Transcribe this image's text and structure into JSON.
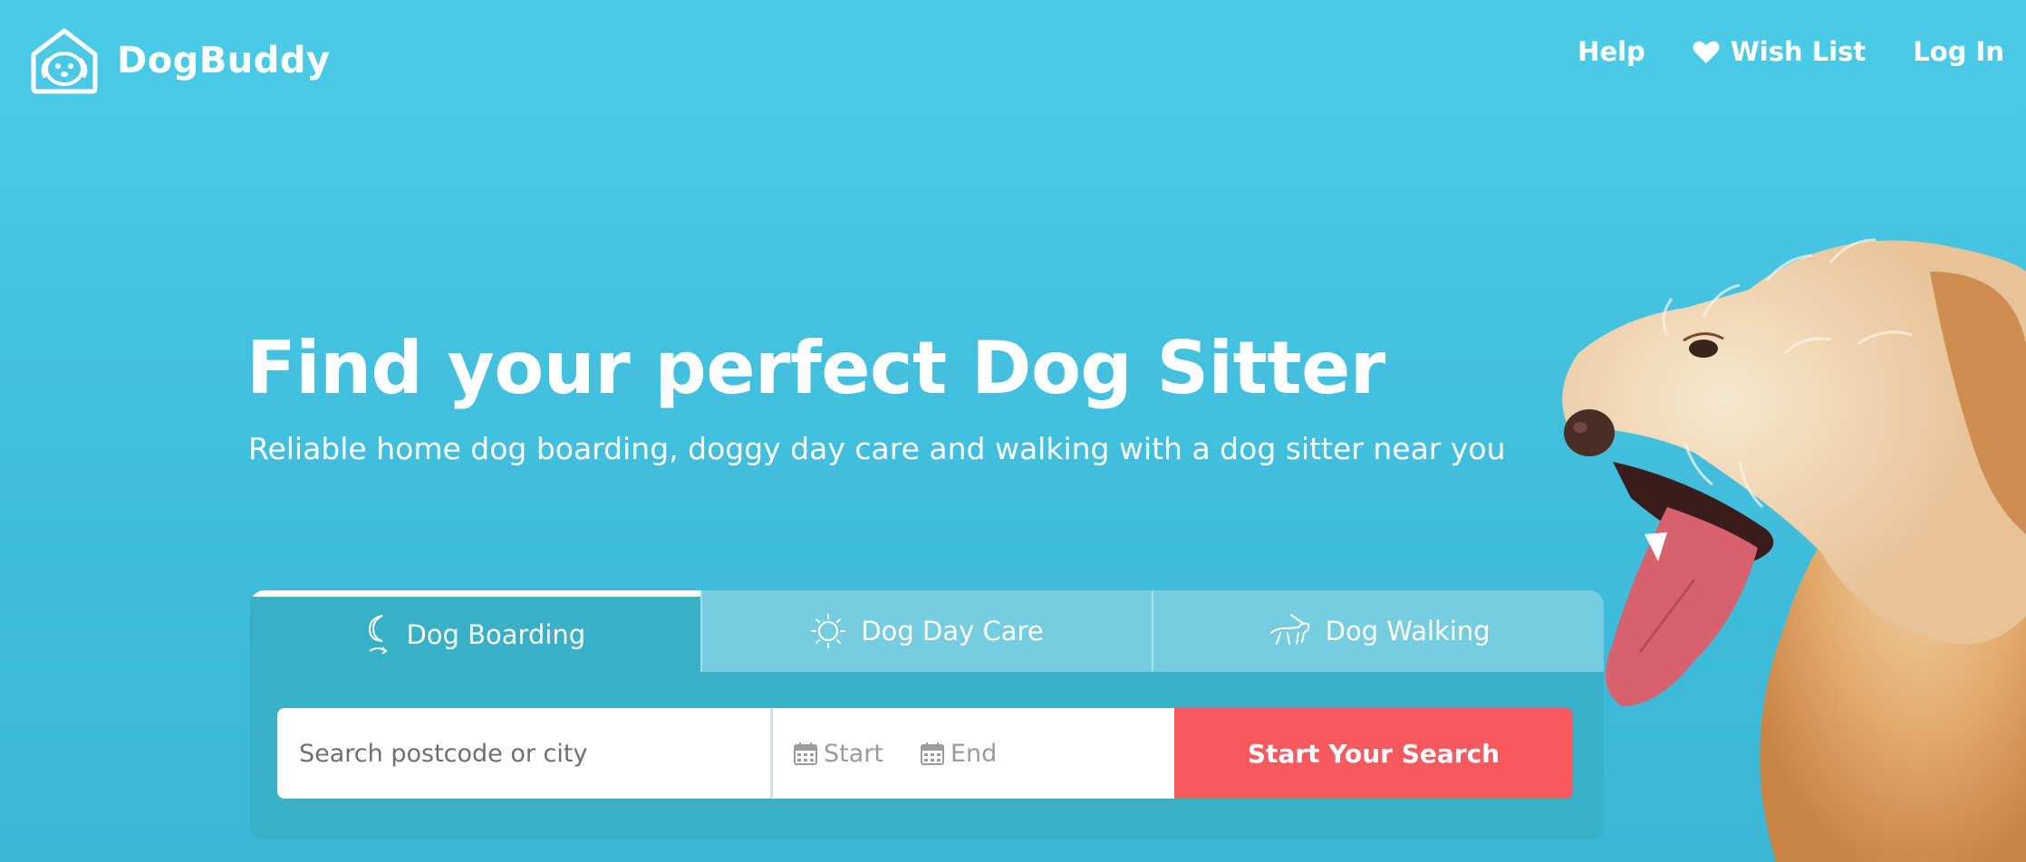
{
  "brand": {
    "name": "DogBuddy",
    "logo_icon": "dog-house-icon"
  },
  "nav": {
    "help": "Help",
    "wishlist": "Wish List",
    "wishlist_icon": "heart-icon",
    "login": "Log In"
  },
  "hero": {
    "title": "Find your perfect Dog Sitter",
    "subtitle": "Reliable home dog boarding, doggy day care and walking with a dog sitter near you"
  },
  "tabs": [
    {
      "label": "Dog Boarding",
      "icon": "moon-icon",
      "active": true
    },
    {
      "label": "Dog Day Care",
      "icon": "sun-icon",
      "active": false
    },
    {
      "label": "Dog Walking",
      "icon": "dog-walking-icon",
      "active": false
    }
  ],
  "search": {
    "placeholder": "Search postcode or city",
    "start": "Start",
    "end": "End",
    "button": "Start Your Search"
  },
  "colors": {
    "background": "#44c1df",
    "panel": "#38b1c6",
    "inactive_tab": "#76cddf",
    "button": "#f65a5e"
  }
}
